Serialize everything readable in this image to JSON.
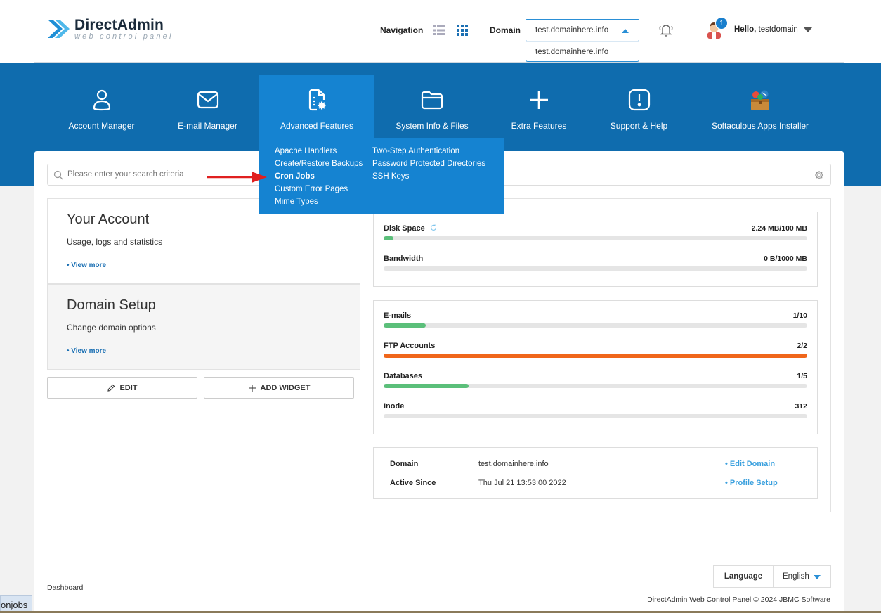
{
  "header": {
    "logo_title": "DirectAdmin",
    "logo_subtitle": "web control panel",
    "navigation_label": "Navigation",
    "domain_label": "Domain",
    "domain_selected": "test.domainhere.info",
    "domain_options": [
      "test.domainhere.info"
    ],
    "notification_count": "1",
    "hello_prefix": "Hello,",
    "username": "testdomain"
  },
  "menu": [
    {
      "label": "Account Manager",
      "icon": "user-icon"
    },
    {
      "label": "E-mail Manager",
      "icon": "envelope-icon"
    },
    {
      "label": "Advanced Features",
      "icon": "file-gear-icon",
      "active": true
    },
    {
      "label": "System Info & Files",
      "icon": "folder-icon"
    },
    {
      "label": "Extra Features",
      "icon": "plus-icon"
    },
    {
      "label": "Support & Help",
      "icon": "exclamation-icon"
    },
    {
      "label": "Softaculous Apps Installer",
      "icon": "softaculous-icon"
    }
  ],
  "advanced_dropdown": {
    "col1": [
      "Apache Handlers",
      "Create/Restore Backups",
      "Cron Jobs",
      "Custom Error Pages",
      "Mime Types"
    ],
    "col2": [
      "Two-Step Authentication",
      "Password Protected Directories",
      "SSH Keys"
    ]
  },
  "search": {
    "placeholder": "Please enter your search criteria"
  },
  "cards": [
    {
      "title": "Your Account",
      "desc": "Usage, logs and statistics",
      "link": "View more"
    },
    {
      "title": "Domain Setup",
      "desc": "Change domain options",
      "link": "View more"
    }
  ],
  "buttons": {
    "edit": "EDIT",
    "add_widget": "ADD WIDGET"
  },
  "usage": [
    {
      "label": "Disk Space",
      "value": "2.24 MB/100 MB",
      "fraction": 0.0224,
      "color": "#5bbf7a"
    },
    {
      "label": "Bandwidth",
      "value": "0 B/1000 MB",
      "fraction": 0,
      "color": "#5bbf7a"
    }
  ],
  "counts": [
    {
      "label": "E-mails",
      "value": "1/10",
      "fraction": 0.1,
      "color": "#5bbf7a"
    },
    {
      "label": "FTP Accounts",
      "value": "2/2",
      "fraction": 1.0,
      "color": "#f0661a"
    },
    {
      "label": "Databases",
      "value": "1/5",
      "fraction": 0.2,
      "color": "#5bbf7a"
    },
    {
      "label": "Inode",
      "value": "312",
      "fraction": 0,
      "color": "#5bbf7a"
    }
  ],
  "info": {
    "domain_label": "Domain",
    "domain_value": "test.domainhere.info",
    "active_label": "Active Since",
    "active_value": "Thu Jul 21 13:53:00 2022",
    "edit_domain": "• Edit Domain",
    "profile_setup": "• Profile Setup"
  },
  "language": {
    "label": "Language",
    "value": "English"
  },
  "footer": {
    "breadcrumb": "Dashboard",
    "copyright": "DirectAdmin Web Control Panel © 2024 JBMC Software",
    "status_tip": "onjobs"
  }
}
